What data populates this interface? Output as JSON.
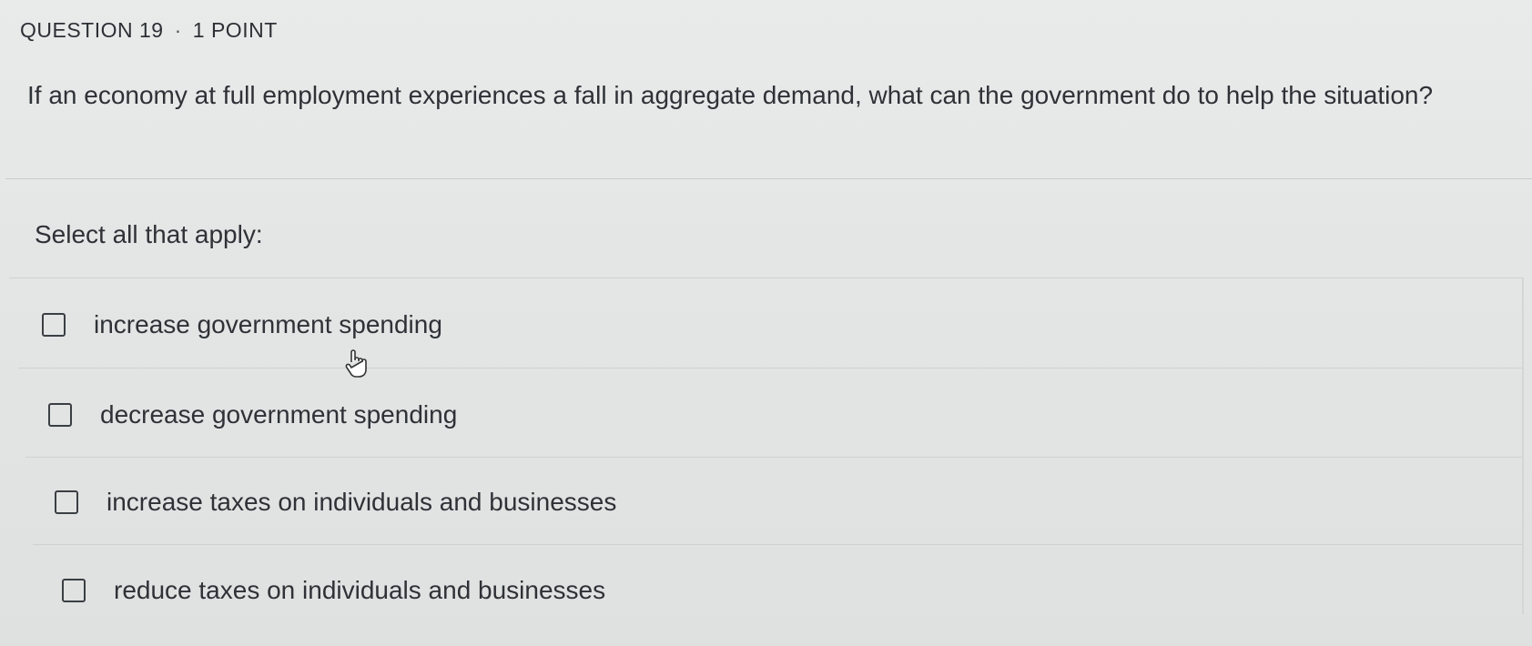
{
  "header": {
    "question_number": "QUESTION 19",
    "separator": "·",
    "points": "1 POINT"
  },
  "question": {
    "text": "If an economy at full employment experiences a fall in aggregate demand, what can  the government do to help the situation?"
  },
  "instruction": "Select all that apply:",
  "options": [
    {
      "label": "increase government spending",
      "checked": false
    },
    {
      "label": "decrease government spending",
      "checked": false
    },
    {
      "label": "increase taxes on individuals and businesses",
      "checked": false
    },
    {
      "label": "reduce taxes on individuals and businesses",
      "checked": false
    }
  ],
  "icons": {
    "cursor": "hand-pointer-icon",
    "checkbox": "checkbox-unchecked-icon"
  },
  "colors": {
    "background": "#e6e8e8",
    "text": "#2e3236",
    "divider": "#cfd2d2",
    "checkbox_border": "#3a3f44"
  }
}
